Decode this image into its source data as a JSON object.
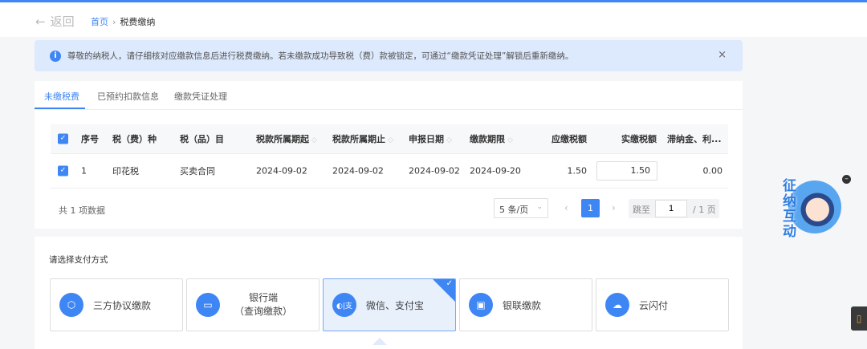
{
  "header": {
    "back_label": "返回",
    "breadcrumb": [
      "首页",
      "税费缴纳"
    ]
  },
  "alert": {
    "text": "尊敬的纳税人，请仔细核对应缴款信息后进行税费缴纳。若未缴款成功导致税（费）款被锁定，可通过“缴款凭证处理”解锁后重新缴纳。",
    "close": "×"
  },
  "tabs": [
    "未缴税费",
    "已预约扣款信息",
    "缴款凭证处理"
  ],
  "table": {
    "columns": [
      "序号",
      "税（费）种",
      "税（品）目",
      "税款所属期起",
      "税款所属期止",
      "申报日期",
      "缴款期限",
      "应缴税额",
      "实缴税额",
      "滞纳金、利..."
    ],
    "rows": [
      {
        "no": "1",
        "tax": "印花税",
        "item": "买卖合同",
        "start": "2024-09-02",
        "end": "2024-09-02",
        "declare": "2024-09-02",
        "deadline": "2024-09-20",
        "due": "1.50",
        "paid": "1.50",
        "late": "0.00"
      }
    ]
  },
  "pagination": {
    "total": "共 1 项数据",
    "page_size": "5 条/页",
    "current": "1",
    "jump_label": "跳至",
    "jump_value": "1",
    "pages": "/ 1 页"
  },
  "payment": {
    "title": "请选择支付方式",
    "options": [
      {
        "label": "三方协议缴款",
        "icon": "hexagon-y-icon"
      },
      {
        "label": "银行端",
        "label2": "（查询缴款）",
        "icon": "card-icon"
      },
      {
        "label": "微信、支付宝",
        "icon": "wechat-alipay-icon",
        "selected": true
      },
      {
        "label": "银联缴款",
        "icon": "unionpay-card-icon"
      },
      {
        "label": "云闪付",
        "icon": "cloud-icon"
      }
    ]
  },
  "mascot": {
    "text": "征纳互动"
  },
  "colors": {
    "accent": "#3f86f5",
    "alert_bg": "#dde9fd"
  }
}
